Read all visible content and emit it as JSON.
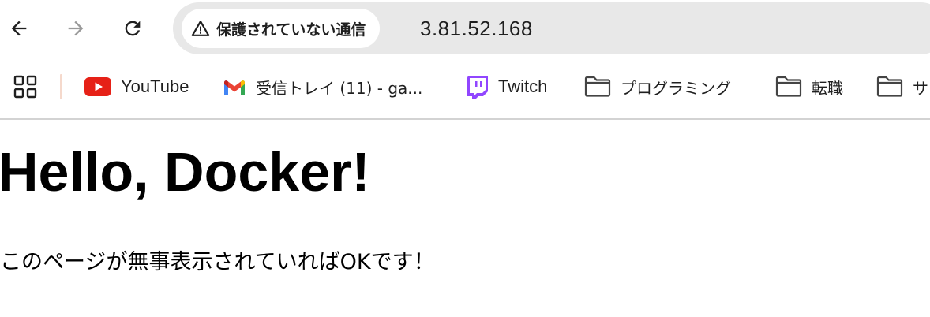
{
  "browser": {
    "security_label": "保護されていない通信",
    "url": "3.81.52.168"
  },
  "bookmarks": [
    {
      "label": "YouTube",
      "icon": "youtube-icon"
    },
    {
      "label": "受信トレイ (11) - ga...",
      "icon": "gmail-icon"
    },
    {
      "label": "Twitch",
      "icon": "twitch-icon"
    },
    {
      "label": "プログラミング",
      "icon": "folder-icon"
    },
    {
      "label": "転職",
      "icon": "folder-icon"
    },
    {
      "label": "サ",
      "icon": "folder-icon"
    }
  ],
  "page": {
    "heading": "Hello, Docker!",
    "message": "このページが無事表示されていればOKです！"
  },
  "colors": {
    "youtube": "#e62117",
    "twitch": "#9146ff",
    "omnibox_bg": "#e8e8e8"
  }
}
